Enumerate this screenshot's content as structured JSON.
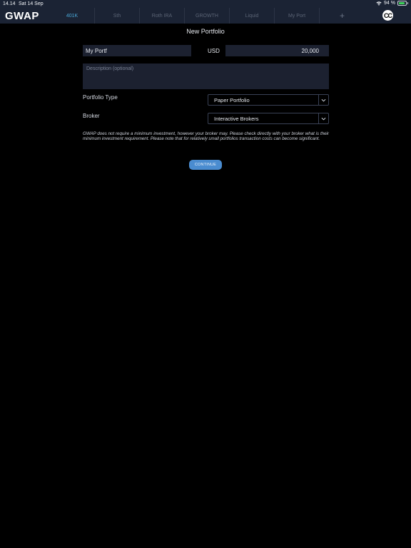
{
  "status_bar": {
    "time": "14.14",
    "date": "Sat 14 Sep",
    "battery_percent": "94 %",
    "battery_level": 0.94,
    "battery_color": "#3fd15a"
  },
  "nav": {
    "logo": "GWAP",
    "tabs": [
      {
        "label": "401K",
        "active": true
      },
      {
        "label": "Sth"
      },
      {
        "label": "Roth IRA"
      },
      {
        "label": "GROWTH"
      },
      {
        "label": "Liquid"
      },
      {
        "label": "My Port"
      },
      {
        "label": "+"
      }
    ],
    "avatar_initials": "CC",
    "accent_color": "#4aa8d8"
  },
  "form": {
    "title": "New Portfolio",
    "name_value": "My Portf",
    "currency": "USD",
    "amount_value": "20,000",
    "description_placeholder": "Description (optional)",
    "portfolio_type_label": "Portfolio Type",
    "portfolio_type_value": "Paper Portfolio",
    "broker_label": "Broker",
    "broker_value": "Interactive Brokers",
    "disclaimer": "GWAP does not require a minimum investment, however your broker may. Please check directly with your broker what is their minimum investment requirement. Please note that for relatively small portfolios transaction costs can become significant.",
    "continue_label": "CONTINUE",
    "button_color": "#4a8cd0"
  }
}
